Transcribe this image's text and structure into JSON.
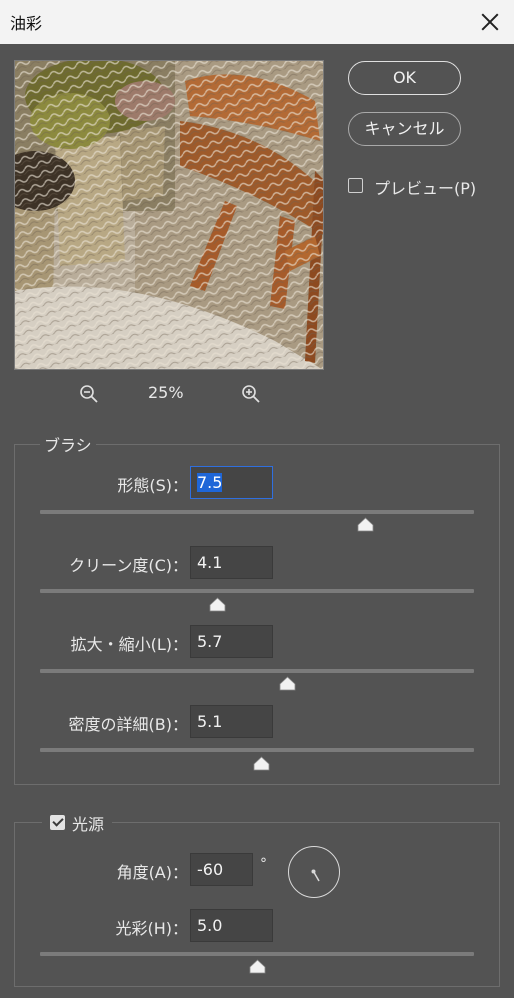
{
  "window": {
    "title": "油彩"
  },
  "buttons": {
    "ok": "OK",
    "cancel": "キャンセル"
  },
  "preview_toggle": {
    "label": "プレビュー(P)",
    "checked": false
  },
  "zoom": {
    "level": "25%"
  },
  "brush": {
    "legend": "ブラシ",
    "stylization": {
      "label": "形態(S)：",
      "value": "7.5",
      "fraction": 0.75
    },
    "cleanliness": {
      "label": "クリーン度(C)：",
      "value": "4.1",
      "fraction": 0.41
    },
    "scale": {
      "label": "拡大・縮小(L)：",
      "value": "5.7",
      "fraction": 0.57
    },
    "bristle_detail": {
      "label": "密度の詳細(B)：",
      "value": "5.1",
      "fraction": 0.51
    }
  },
  "lighting": {
    "legend": "光源",
    "enabled": true,
    "angle": {
      "label": "角度(A)：",
      "value": "-60",
      "unit": "°"
    },
    "shine": {
      "label": "光彩(H)：",
      "value": "5.0",
      "fraction": 0.5
    }
  }
}
